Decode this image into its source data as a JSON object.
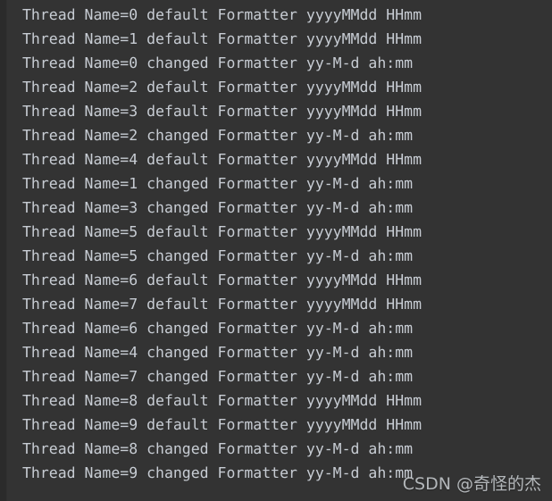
{
  "window": {
    "background_color": "#333333",
    "gutter_color": "#2b2b2b",
    "text_color": "#c7ccd3"
  },
  "console": {
    "lines": [
      "Thread Name=0 default Formatter yyyyMMdd HHmm",
      "Thread Name=1 default Formatter yyyyMMdd HHmm",
      "Thread Name=0 changed Formatter yy-M-d ah:mm",
      "Thread Name=2 default Formatter yyyyMMdd HHmm",
      "Thread Name=3 default Formatter yyyyMMdd HHmm",
      "Thread Name=2 changed Formatter yy-M-d ah:mm",
      "Thread Name=4 default Formatter yyyyMMdd HHmm",
      "Thread Name=1 changed Formatter yy-M-d ah:mm",
      "Thread Name=3 changed Formatter yy-M-d ah:mm",
      "Thread Name=5 default Formatter yyyyMMdd HHmm",
      "Thread Name=5 changed Formatter yy-M-d ah:mm",
      "Thread Name=6 default Formatter yyyyMMdd HHmm",
      "Thread Name=7 default Formatter yyyyMMdd HHmm",
      "Thread Name=6 changed Formatter yy-M-d ah:mm",
      "Thread Name=4 changed Formatter yy-M-d ah:mm",
      "Thread Name=7 changed Formatter yy-M-d ah:mm",
      "Thread Name=8 default Formatter yyyyMMdd HHmm",
      "Thread Name=9 default Formatter yyyyMMdd HHmm",
      "Thread Name=8 changed Formatter yy-M-d ah:mm",
      "Thread Name=9 changed Formatter yy-M-d ah:mm"
    ]
  },
  "watermark": {
    "text": "CSDN @奇怪的杰"
  }
}
